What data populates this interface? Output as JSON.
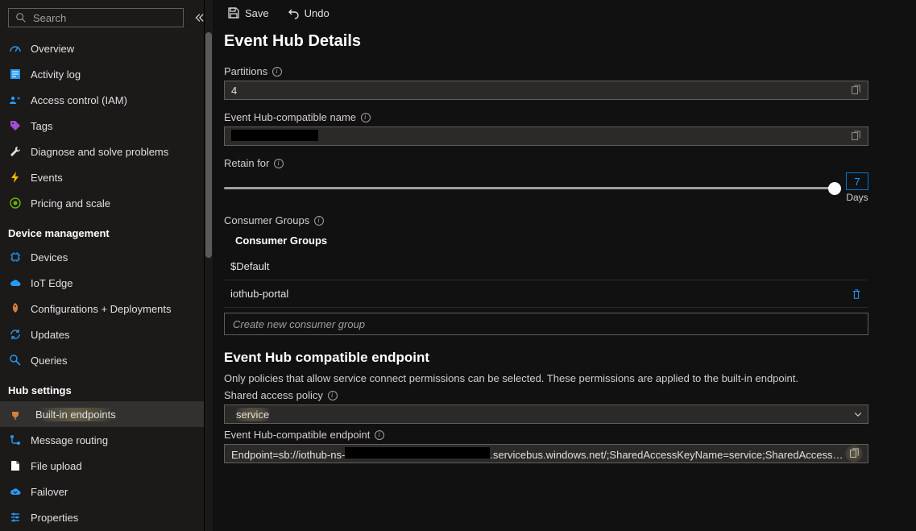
{
  "search": {
    "placeholder": "Search"
  },
  "sidebar": {
    "top": [
      {
        "icon": "speedometer",
        "label": "Overview",
        "color": "#2899f5"
      },
      {
        "icon": "log",
        "label": "Activity log",
        "color": "#2899f5"
      },
      {
        "icon": "iam",
        "label": "Access control (IAM)",
        "color": "#2899f5"
      },
      {
        "icon": "tag",
        "label": "Tags",
        "color": "#a04cd8"
      },
      {
        "icon": "wrench",
        "label": "Diagnose and solve problems",
        "color": "#e0e0e0"
      },
      {
        "icon": "bolt",
        "label": "Events",
        "color": "#ffb900"
      },
      {
        "icon": "target",
        "label": "Pricing and scale",
        "color": "#6bb700"
      }
    ],
    "sections": [
      {
        "title": "Device management",
        "items": [
          {
            "icon": "chip",
            "label": "Devices",
            "color": "#2899f5"
          },
          {
            "icon": "cloud",
            "label": "IoT Edge",
            "color": "#2899f5"
          },
          {
            "icon": "rocket",
            "label": "Configurations + Deployments",
            "color": "#d67f3c"
          },
          {
            "icon": "refresh",
            "label": "Updates",
            "color": "#2899f5"
          },
          {
            "icon": "query",
            "label": "Queries",
            "color": "#2899f5"
          }
        ]
      },
      {
        "title": "Hub settings",
        "items": [
          {
            "icon": "plug",
            "label": "Built-in endpoints",
            "color": "#d67f3c",
            "active": true,
            "highlighted": true
          },
          {
            "icon": "route",
            "label": "Message routing",
            "color": "#2899f5"
          },
          {
            "icon": "file",
            "label": "File upload",
            "color": "#ffffff"
          },
          {
            "icon": "failover",
            "label": "Failover",
            "color": "#2899f5"
          },
          {
            "icon": "props",
            "label": "Properties",
            "color": "#2899f5"
          }
        ]
      }
    ]
  },
  "toolbar": {
    "save_label": "Save",
    "undo_label": "Undo"
  },
  "page": {
    "title": "Event Hub Details",
    "partitions_label": "Partitions",
    "partitions_value": "4",
    "ehname_label": "Event Hub-compatible name",
    "ehname_value": "",
    "retain_label": "Retain for",
    "retain_value": "7",
    "retain_unit": "Days",
    "cg_label": "Consumer Groups",
    "cg_header": "Consumer Groups",
    "cg_rows": [
      "$Default",
      "iothub-portal"
    ],
    "cg_placeholder": "Create new consumer group",
    "endpoint_title": "Event Hub compatible endpoint",
    "endpoint_desc": "Only policies that allow service connect permissions can be selected. These permissions are applied to the built-in endpoint.",
    "policy_label": "Shared access policy",
    "policy_value": "service",
    "compat_label": "Event Hub-compatible endpoint",
    "compat_prefix": "Endpoint=sb://iothub-ns-",
    "compat_suffix": ".servicebus.windows.net/;SharedAccessKeyName=service;SharedAccessK…"
  }
}
